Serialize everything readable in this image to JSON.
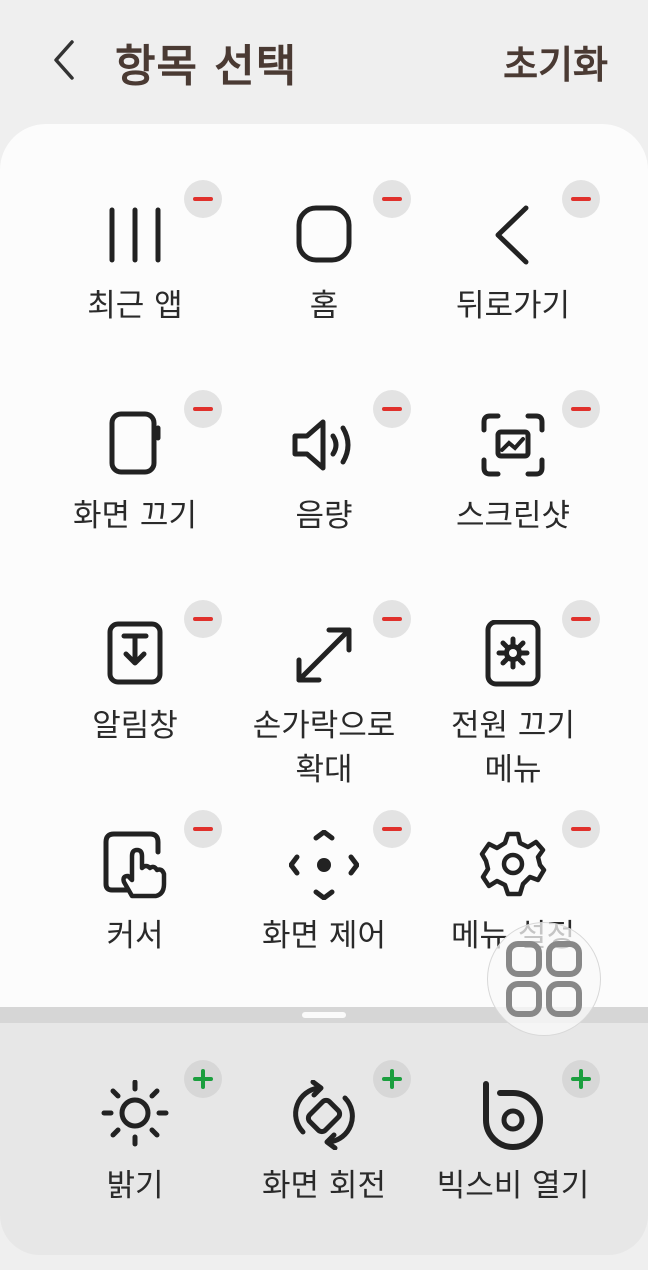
{
  "header": {
    "title": "항목 선택",
    "reset_label": "초기화"
  },
  "selected_items": [
    {
      "label": "최근 앱",
      "icon": "recent-apps-icon"
    },
    {
      "label": "홈",
      "icon": "home-icon"
    },
    {
      "label": "뒤로가기",
      "icon": "back-icon"
    },
    {
      "label": "화면 끄기",
      "icon": "screen-off-icon"
    },
    {
      "label": "음량",
      "icon": "volume-icon"
    },
    {
      "label": "스크린샷",
      "icon": "screenshot-icon"
    },
    {
      "label": "알림창",
      "icon": "notification-panel-icon"
    },
    {
      "label": "손가락으로\n확대",
      "icon": "magnify-icon"
    },
    {
      "label": "전원 끄기\n메뉴",
      "icon": "power-menu-icon"
    },
    {
      "label": "커서",
      "icon": "cursor-icon"
    },
    {
      "label": "화면 제어",
      "icon": "screen-control-icon"
    },
    {
      "label": "메뉴 설정",
      "icon": "settings-icon"
    }
  ],
  "available_items": [
    {
      "label": "밝기",
      "icon": "brightness-icon"
    },
    {
      "label": "화면 회전",
      "icon": "rotate-icon"
    },
    {
      "label": "빅스비 열기",
      "icon": "bixby-icon"
    }
  ],
  "colors": {
    "remove": "#e0312c",
    "add": "#1b9e3e",
    "title": "#4a3a33"
  }
}
